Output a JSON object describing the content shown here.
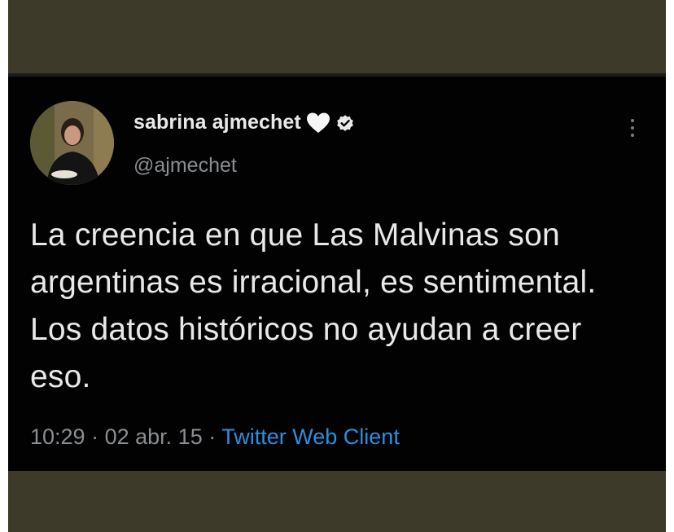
{
  "tweet": {
    "author": {
      "display_name": "sabrina ajmechet",
      "handle": "@ajmechet",
      "badge_icons": [
        "white-heart-icon",
        "verified-badge-icon"
      ]
    },
    "text": "La creencia en que Las Malvinas son argentinas es irracional, es sentimental. Los datos históricos no ayudan a creer eso.",
    "time": "10:29",
    "date": "02 abr. 15",
    "separator": "·",
    "source": "Twitter Web Client",
    "menu_icon": "more-vertical-icon"
  },
  "colors": {
    "background_frame": "#3e3a29",
    "card_background": "#020202",
    "primary_text": "#e8e8e8",
    "secondary_text": "#8a8d91",
    "link": "#2d8ee0"
  }
}
